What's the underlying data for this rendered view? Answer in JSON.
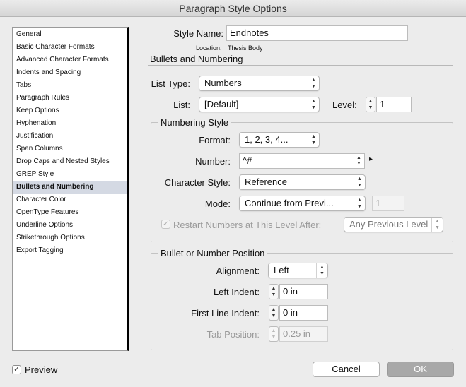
{
  "window": {
    "title": "Paragraph Style Options"
  },
  "sidebar": {
    "items": [
      {
        "label": "General"
      },
      {
        "label": "Basic Character Formats"
      },
      {
        "label": "Advanced Character Formats"
      },
      {
        "label": "Indents and Spacing"
      },
      {
        "label": "Tabs"
      },
      {
        "label": "Paragraph Rules"
      },
      {
        "label": "Keep Options"
      },
      {
        "label": "Hyphenation"
      },
      {
        "label": "Justification"
      },
      {
        "label": "Span Columns"
      },
      {
        "label": "Drop Caps and Nested Styles"
      },
      {
        "label": "GREP Style"
      },
      {
        "label": "Bullets and Numbering"
      },
      {
        "label": "Character Color"
      },
      {
        "label": "OpenType Features"
      },
      {
        "label": "Underline Options"
      },
      {
        "label": "Strikethrough Options"
      },
      {
        "label": "Export Tagging"
      }
    ],
    "selected": "Bullets and Numbering"
  },
  "header": {
    "style_name_label": "Style Name:",
    "style_name_value": "Endnotes",
    "location_label": "Location:",
    "location_value": "Thesis Body",
    "section_title": "Bullets and Numbering"
  },
  "list": {
    "list_type_label": "List Type:",
    "list_type_value": "Numbers",
    "list_label": "List:",
    "list_value": "[Default]",
    "level_label": "Level:",
    "level_value": "1"
  },
  "numbering_style": {
    "legend": "Numbering Style",
    "format_label": "Format:",
    "format_value": "1, 2, 3, 4...",
    "number_label": "Number:",
    "number_value": "^#",
    "char_style_label": "Character Style:",
    "char_style_value": "Reference",
    "mode_label": "Mode:",
    "mode_value": "Continue from Previ...",
    "mode_start_value": "1",
    "restart_label": "Restart Numbers at This Level After:",
    "restart_value": "Any Previous Level"
  },
  "position": {
    "legend": "Bullet or Number Position",
    "alignment_label": "Alignment:",
    "alignment_value": "Left",
    "left_indent_label": "Left Indent:",
    "left_indent_value": "0 in",
    "first_line_label": "First Line Indent:",
    "first_line_value": "0 in",
    "tab_position_label": "Tab Position:",
    "tab_position_value": "0.25 in"
  },
  "footer": {
    "preview_label": "Preview",
    "cancel_label": "Cancel",
    "ok_label": "OK"
  }
}
